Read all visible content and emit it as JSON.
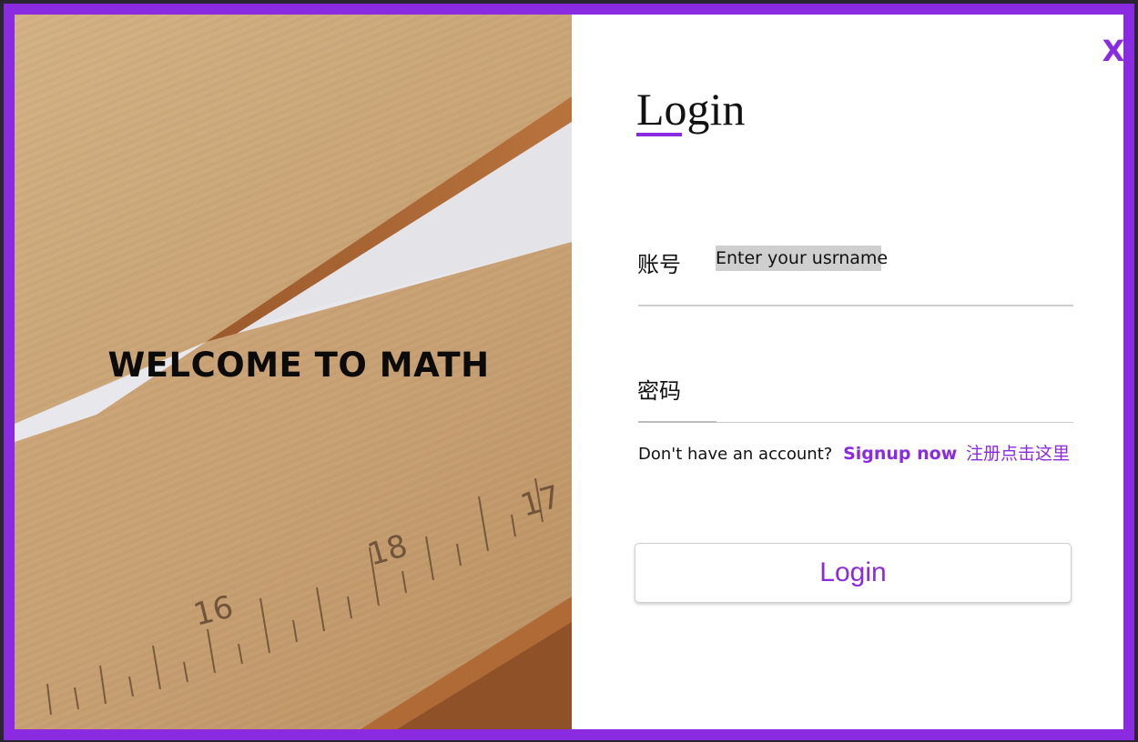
{
  "hero": {
    "title": "WELCOME TO MATH",
    "image_subject": "wooden-ruler-photo",
    "ruler_ticks": [
      "16",
      "18",
      "17"
    ]
  },
  "dialog": {
    "close_label": "X",
    "heading": "Login",
    "username": {
      "label": "账号",
      "placeholder": "Enter your usrname",
      "value": ""
    },
    "password": {
      "label": "密码",
      "value": ""
    },
    "signup": {
      "prompt": "Don't have an account?",
      "link_label": "Signup now",
      "link_cn": "注册点击这里"
    },
    "submit_label": "Login"
  },
  "colors": {
    "accent": "#8a2be2",
    "frame": "#8a2be2",
    "text": "#111111",
    "divider": "#c9c9c9"
  }
}
